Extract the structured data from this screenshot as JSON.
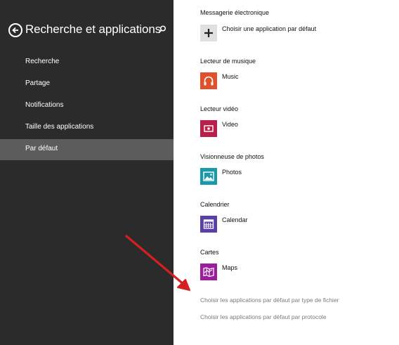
{
  "sidebar": {
    "title": "Recherche et applications",
    "items": [
      {
        "label": "Recherche"
      },
      {
        "label": "Partage"
      },
      {
        "label": "Notifications"
      },
      {
        "label": "Taille des applications"
      },
      {
        "label": "Par défaut",
        "selected": true
      }
    ]
  },
  "defaults": [
    {
      "category": "Messagerie électronique",
      "app": "Choisir une application par défaut",
      "icon": "plus-icon",
      "color": "#e0e0e0"
    },
    {
      "category": "Lecteur de musique",
      "app": "Music",
      "icon": "headphones-icon",
      "color": "#e0502b"
    },
    {
      "category": "Lecteur vidéo",
      "app": "Video",
      "icon": "video-icon",
      "color": "#b8204a"
    },
    {
      "category": "Visionneuse de photos",
      "app": "Photos",
      "icon": "photos-icon",
      "color": "#1a9aa6"
    },
    {
      "category": "Calendrier",
      "app": "Calendar",
      "icon": "calendar-icon",
      "color": "#5a3fa8"
    },
    {
      "category": "Cartes",
      "app": "Maps",
      "icon": "maps-icon",
      "color": "#9b1f9c"
    }
  ],
  "links": {
    "by_file_type": "Choisir les applications par défaut par type de fichier",
    "by_protocol": "Choisir les applications par défaut par protocole"
  },
  "colors": {
    "sidebar_bg": "#2b2b2b",
    "selected_bg": "#5c5c5c",
    "annotation_arrow": "#d42020"
  }
}
